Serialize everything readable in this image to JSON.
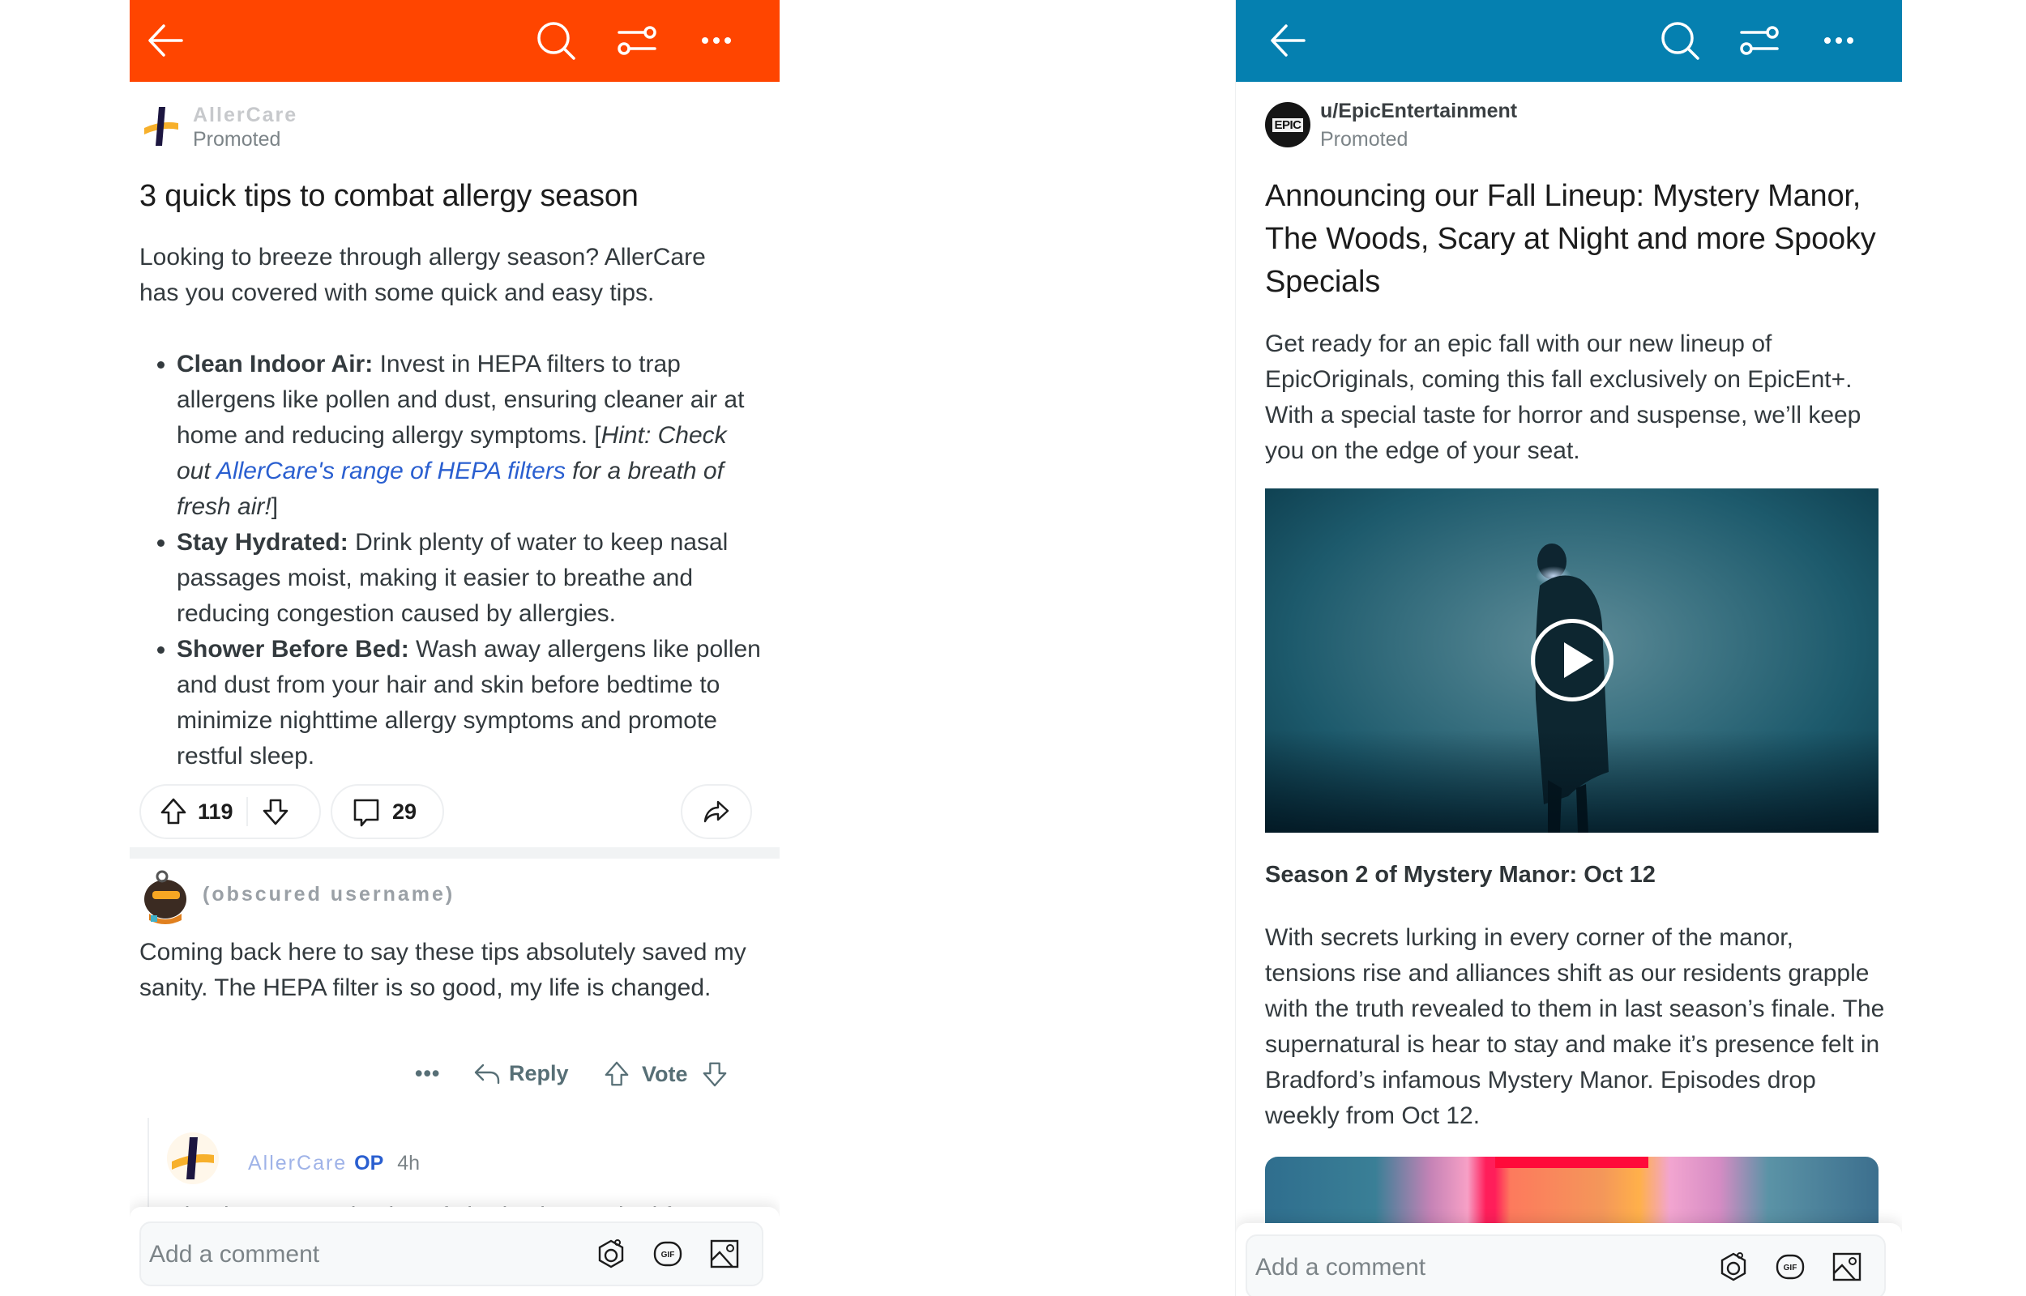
{
  "left_post": {
    "header_color": "#FF4500",
    "header_icons": [
      "back-arrow-icon",
      "search-icon",
      "filter-sliders-icon",
      "more-options-icon"
    ],
    "author": {
      "name": "AllerCare",
      "label": "Promoted"
    },
    "title": "3 quick tips to combat allergy season",
    "intro": "Looking to breeze through allergy season? AllerCare has you covered with some quick and easy tips.",
    "tips": [
      {
        "heading": "Clean Indoor Air:",
        "text": " Invest in HEPA filters to trap allergens like pollen and dust, ensuring cleaner air at home and reducing allergy symptoms. [",
        "hint_prefix": "Hint: Check out ",
        "link": "AllerCare's range of HEPA filters",
        "hint_suffix": " for a breath of fresh air!",
        "close": "]"
      },
      {
        "heading": "Stay Hydrated:",
        "text": " Drink plenty of water to keep nasal passages moist, making it easier to breathe and reducing congestion caused by allergies."
      },
      {
        "heading": "Shower Before Bed:",
        "text": " Wash away allergens like pollen and dust from your hair and skin before bedtime to minimize nighttime allergy symptoms and promote restful sleep."
      }
    ],
    "actions": {
      "upvotes": "119",
      "comments": "29"
    },
    "comment": {
      "author": "(obscured username)",
      "text": "Coming back here to say these tips absolutely saved my sanity. The HEPA filter is so good, my life is changed.",
      "more": "•••",
      "reply": "Reply",
      "vote": "Vote"
    },
    "reply": {
      "author": "AllerCare",
      "op_badge": "OP",
      "time": "4h",
      "text": "Check out our selection of shades best suited for"
    },
    "comment_bar": {
      "placeholder": "Add a comment"
    }
  },
  "right_post": {
    "header_color": "#0580B0",
    "header_icons": [
      "back-arrow-icon",
      "search-icon",
      "filter-sliders-icon",
      "more-options-icon"
    ],
    "author": {
      "avatar_text": "EPIC",
      "name": "u/EpicEntertainment",
      "label": "Promoted"
    },
    "title": "Announcing our Fall Lineup: Mystery Manor, The Woods, Scary at Night and more Spooky Specials",
    "intro": "Get ready for an epic fall with our new lineup of EpicOriginals, coming this fall exclusively on EpicEnt+. With a special taste for horror and suspense, we’ll keep you on the edge of your seat.",
    "section_heading": "Season 2 of Mystery Manor: Oct 12",
    "section_text": "With secrets lurking in every corner of the manor, tensions rise and alliances shift as our residents grapple with the truth revealed to them in last season’s finale. The supernatural is hear to stay and make it’s presence felt in Bradford’s infamous Mystery Manor. Episodes drop weekly from Oct 12.",
    "comment_bar": {
      "placeholder": "Add a comment"
    }
  }
}
